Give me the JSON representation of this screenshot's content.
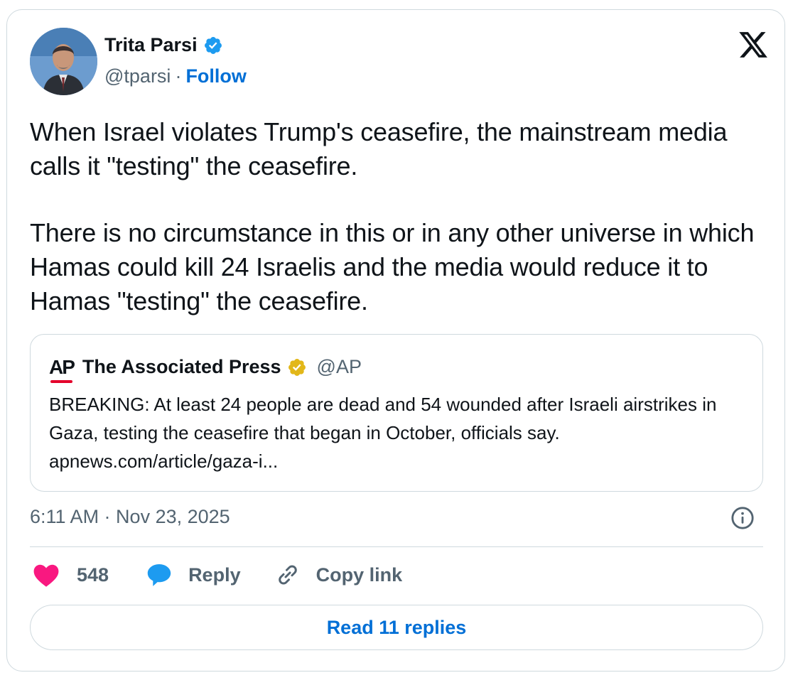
{
  "author": {
    "name": "Trita Parsi",
    "handle": "@tparsi",
    "separator": "·",
    "follow_label": "Follow",
    "verified_badge_color": "#1d9bf0"
  },
  "tweet": {
    "paragraphs": [
      "When Israel violates Trump's ceasefire, the mainstream media calls it \"testing\" the ceasefire.",
      "There is no circumstance in this or in any other universe in which Hamas could kill 24 Israelis and the media would reduce it to Hamas \"testing\" the ceasefire."
    ],
    "timestamp": "6:11 AM · Nov 23, 2025"
  },
  "quote": {
    "logo_text": "AP",
    "name": "The Associated Press",
    "handle": "@AP",
    "verified_badge_color": "#e2b719",
    "text": "BREAKING: At least 24 people are dead and 54 wounded after Israeli airstrikes in Gaza, testing the ceasefire that began in October, officials say. apnews.com/article/gaza-i..."
  },
  "actions": {
    "like_count": "548",
    "reply_label": "Reply",
    "copy_label": "Copy link"
  },
  "read_replies_label": "Read 11 replies",
  "colors": {
    "link_blue": "#006fd6",
    "heart_pink": "#f91880",
    "reply_blue": "#1d9bf0",
    "secondary_text": "#536471",
    "border": "#cfd9de"
  },
  "icons": [
    "verified-badge-icon",
    "x-logo-icon",
    "info-icon",
    "heart-icon",
    "reply-bubble-icon",
    "link-icon"
  ]
}
